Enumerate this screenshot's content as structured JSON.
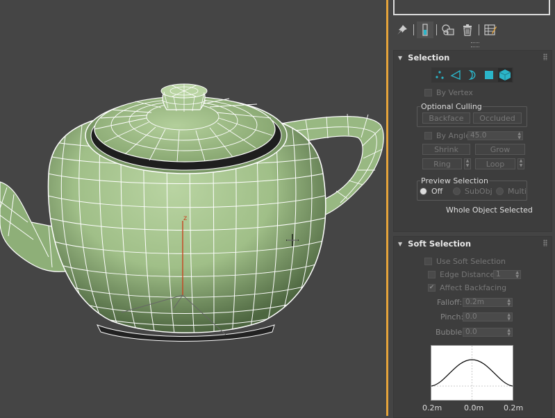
{
  "viewport": {
    "axis_z_label": "z",
    "background": "#454545",
    "teapot_color": "#a7c590"
  },
  "command_panel": {
    "tabs": [
      {
        "icon": "pin-stack-icon"
      },
      {
        "icon": "modifier-list-icon"
      },
      {
        "icon": "make-unique-icon"
      },
      {
        "icon": "remove-modifier-icon"
      },
      {
        "icon": "configure-modifier-sets-icon"
      }
    ],
    "selection": {
      "title": "Selection",
      "levels": [
        "vertex-icon",
        "edge-icon",
        "border-icon",
        "polygon-icon",
        "element-icon"
      ],
      "active_level": "element-icon",
      "by_vertex": "By Vertex",
      "optional_culling": "Optional Culling",
      "backface": "Backface",
      "occluded": "Occluded",
      "by_angle": "By Angle:",
      "by_angle_value": "45.0",
      "shrink": "Shrink",
      "grow": "Grow",
      "ring": "Ring",
      "loop": "Loop",
      "preview_selection": "Preview Selection",
      "preview_options": [
        "Off",
        "SubObj",
        "Multi"
      ],
      "preview_selected": "Off",
      "status": "Whole Object Selected"
    },
    "soft_selection": {
      "title": "Soft Selection",
      "use_soft_selection": "Use Soft Selection",
      "edge_distance": "Edge Distance:",
      "edge_distance_value": "1",
      "affect_backfacing": "Affect Backfacing",
      "affect_backfacing_checked": true,
      "falloff": "Falloff:",
      "falloff_value": "0.2m",
      "pinch": "Pinch:",
      "pinch_value": "0.0",
      "bubble": "Bubble:",
      "bubble_value": "0.0",
      "curve_left": "0.2m",
      "curve_center": "0.0m",
      "curve_right": "0.2m"
    }
  },
  "colors": {
    "accent": "#2bb5c9",
    "panel": "#444444",
    "viewport_border": "#e6a43a"
  }
}
